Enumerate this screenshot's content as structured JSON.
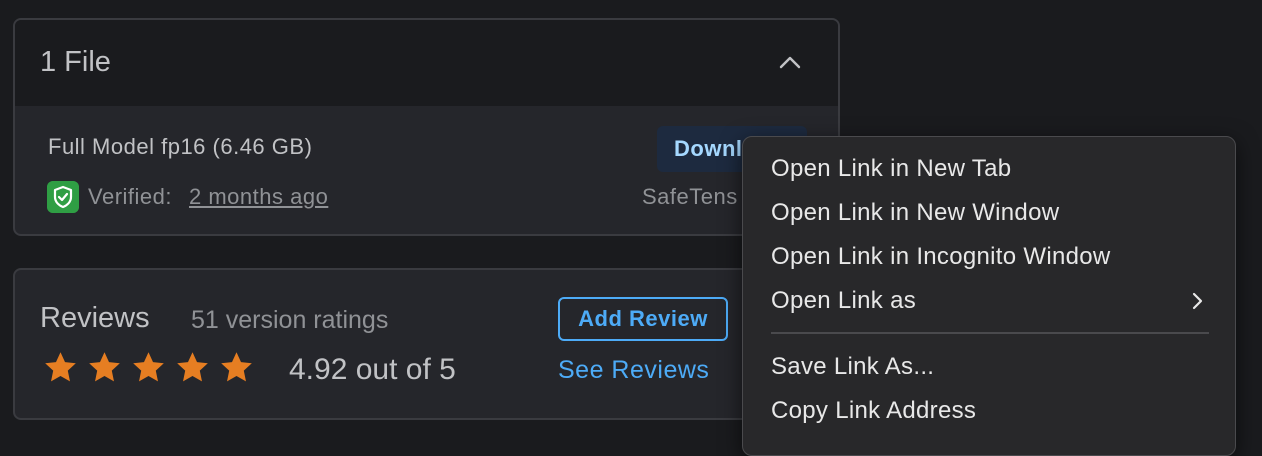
{
  "files": {
    "title": "1 File",
    "file_name": "Full Model fp16 (6.46 GB)",
    "download_label": "Downl",
    "verified_label": "Verified:",
    "verified_time": "2 months ago",
    "format": "SafeTens"
  },
  "reviews": {
    "title": "Reviews",
    "ratings_count": "51 version ratings",
    "rating_text": "4.92 out of 5",
    "star_count": 5,
    "add_review_label": "Add Review",
    "see_reviews_label": "See Reviews"
  },
  "context_menu": {
    "items": [
      "Open Link in New Tab",
      "Open Link in New Window",
      "Open Link in Incognito Window",
      "Open Link as",
      "Save Link As...",
      "Copy Link Address"
    ]
  },
  "colors": {
    "background": "#1a1b1e",
    "panel": "#25262b",
    "accent_blue": "#4dabf7",
    "star": "#e67e22",
    "verified_green": "#2f9e44"
  },
  "icons": [
    "chevron-up-icon",
    "shield-check-icon",
    "star-icon",
    "chevron-right-icon"
  ]
}
